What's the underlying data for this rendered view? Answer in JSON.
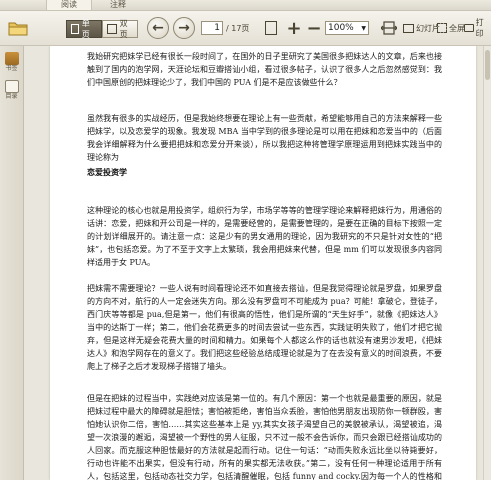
{
  "tabs": [
    {
      "label": "阅读",
      "active": true
    },
    {
      "label": "注释",
      "active": false
    }
  ],
  "toolbar": {
    "single_page_label": "单页",
    "double_page_label": "双页",
    "current_page": "1",
    "total_pages": "/ 17页",
    "zoom_value": "100%",
    "slideshow_label": "幻灯片",
    "fullscreen_label": "全屏",
    "print_label": "打印"
  },
  "sidebar": {
    "items": [
      {
        "label": "书签",
        "icon": "bookmark-icon"
      },
      {
        "label": "目录",
        "icon": "toc-icon"
      }
    ]
  },
  "document": {
    "para1": "我始研究把妹学已经有很长一段时间了，在国外的日子里研究了美国很多把妹达人的文章，后来也接触到了国内的泡学网，天涯论坛和豆瓣搭讪小组，看过很多帖子，认识了很多人之后忽然感觉到：我们中国原创的把妹理论少了，我们中国的 PUA 们是不是应该做些什么？",
    "para2": "虽然我有很多的实战经历，但是我始终想要在理论上有一些贡献，希望能够用自己的方法来解释一些把妹学，以及恋爱学的现象。我发现 MBA 当中学到的很多理论是可以用在把妹和恋爱当中的（后面我会详细解释为什么要把把妹和恋爱分开来谈），所以我把这种将管理学原理运用到把妹实践当中的理论称为",
    "heading": "恋爱投资学",
    "para3": "这种理论的核心也就是用投资学，组织行为学，市场学等等的管理学理论来解释把妹行为，用通俗的话讲：恋爱，把妹和开公司是一样的，是需要经营的，是需要管理的，是要在正确的目标下按照一定的计划详细展开的。请注意一点：这是少有的男女通用的理论，因为我研究的不只是针对女性的“把妹”，也包括恋爱。为了不至于文字上太繁琐，我会用把妹来代替，但是 mm 们可以发现很多内容同样适用于女 PUA。",
    "para4": "把妹需不需要理论？一些人说有时间看理论还不如直接去搭讪，但是我觉得理论就是罗盘，如果罗盘的方向不对，航行的人一定会迷失方向。那么没有罗盘可不可能成为 pua？可能！拿破仑，登徒子，西门庆等等都是 pua,但是第一，他们有很高的悟性，他们是所谓的“天生好手”，就像《把妹达人》当中的达斯丁一样；第二，他们会花费更多的时间去尝试一些东西，实践证明失败了，他们才把它抛弃，但是这样无疑会花费大量的时间和精力。如果每个人都这么作的话也就没有速男沙发吧，《把妹达人》和泡学网存在的意义了。我们把这些经验总结成理论就是为了在去没有意义的时间浪费，不要爬上了梯子之后才发现梯子搭错了墙头。",
    "para5": "但是在把妹的过程当中，实践绝对应该是第一位的。有几个原因：第一个也就是最重要的原因，就是把妹过程中最大的障碍就是胆怯；害怕被拒绝，害怕当众丢脸，害怕他男朋友出现防你一顿群殴，害怕她认识你二倍，害怕……其实这些基本上是 yy,其实女孩子渴望自己的美貌被承认，渴望被追，渴望一次浪漫的邂逅，渴望被一个野性的男人征服，只不过一般不会告诉你，而只会跟已经搭讪成功的人回家。而克服这种胆怯最好的方法就是起而行动。记住一句话：“动而失败永远比坐以待毙要好，行动也许能不出果实，但没有行动，所有的果实都无法收获。”第二，没有任何一种理论适用于所有人，包括这里，包括动态社交力学，包括清醒催眠，包括 funny and cocky.因为每一个人的性格和经历是不一样的，只有在经过实践的验证过了之后，理论才会有它的意义。"
  }
}
